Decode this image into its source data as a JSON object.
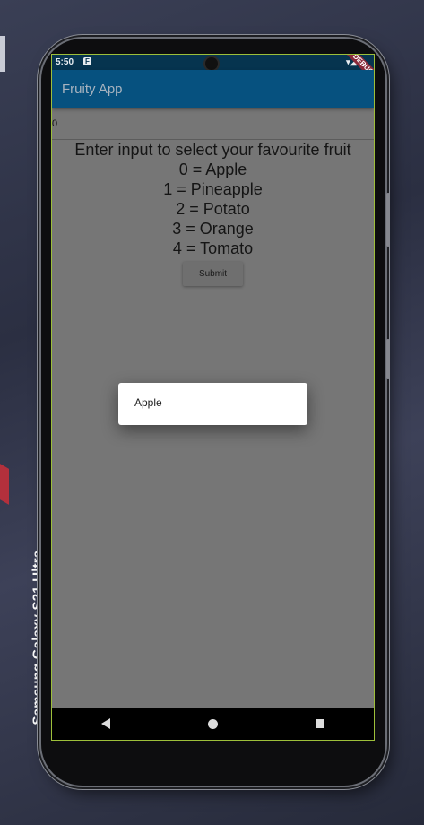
{
  "device_label": "Samsung Galaxy  S21 Ultra",
  "status_bar": {
    "time": "5:50",
    "app_icon": "F",
    "debug_banner": "DEBUG",
    "icons": "▾◢ ▮"
  },
  "app_bar": {
    "title": "Fruity App"
  },
  "input": {
    "value": "0"
  },
  "content": {
    "prompt": "Enter input to select your favourite fruit",
    "options": [
      "0 = Apple",
      "1 = Pineapple",
      "2 = Potato",
      "3 = Orange",
      "4 = Tomato"
    ]
  },
  "submit_label": "Submit",
  "dialog": {
    "text": "Apple"
  },
  "nav_icons": [
    "back-icon",
    "home-icon",
    "recents-icon"
  ]
}
